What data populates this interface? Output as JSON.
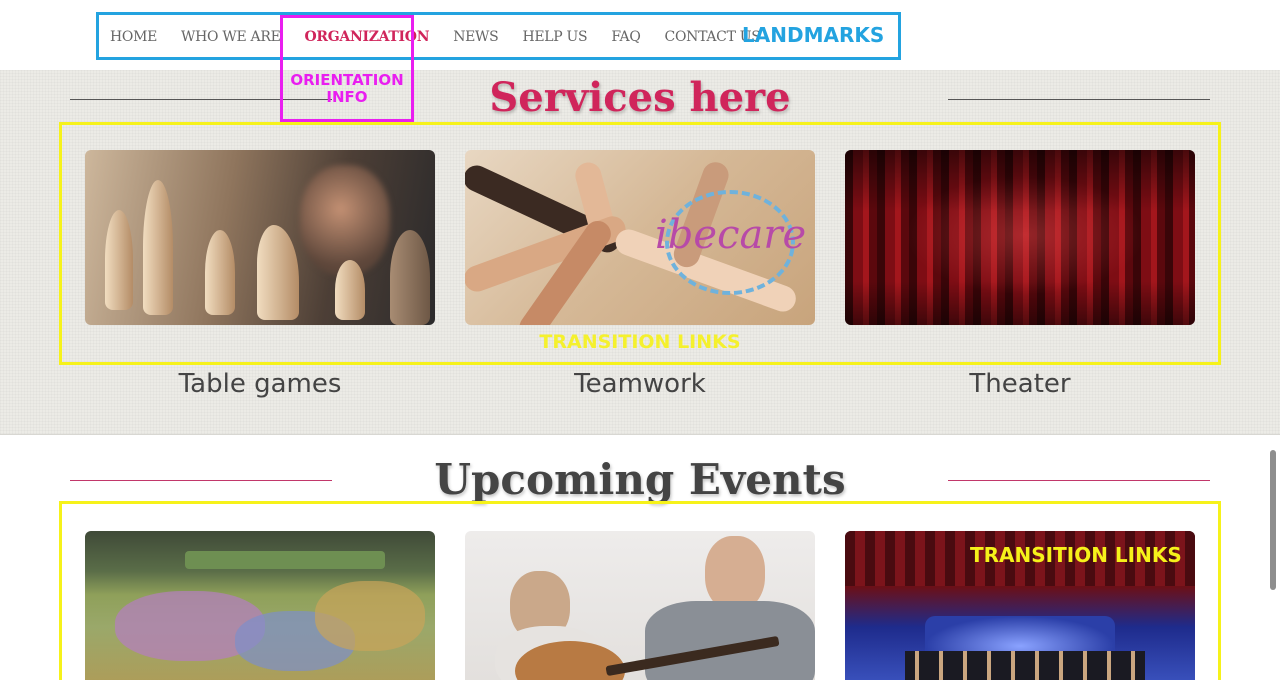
{
  "nav": {
    "items": [
      {
        "label": "HOME"
      },
      {
        "label": "WHO WE ARE"
      },
      {
        "label": "ORGANIZATION"
      },
      {
        "label": "NEWS"
      },
      {
        "label": "HELP US"
      },
      {
        "label": "FAQ"
      },
      {
        "label": "CONTACT US"
      }
    ],
    "active_item": "ORGANIZATION"
  },
  "annotations": {
    "landmarks": "LANDMARKS",
    "orientation_info": "ORIENTATION INFO",
    "transition_links_1": "TRANSITION LINKS",
    "transition_links_2": "TRANSITION LINKS"
  },
  "services": {
    "title": "Services here",
    "cards": [
      {
        "caption": "Table games",
        "image": "chess-photo"
      },
      {
        "caption": "Teamwork",
        "image": "hands-together-photo"
      },
      {
        "caption": "Theater",
        "image": "red-curtain-photo"
      }
    ]
  },
  "events": {
    "title": "Upcoming Events",
    "cards": [
      {
        "image": "giant-map-game-photo"
      },
      {
        "image": "guitar-lesson-photo"
      },
      {
        "image": "theater-stage-photo"
      }
    ]
  },
  "colors": {
    "accent": "#d0255b",
    "landmarks": "#23a3e0",
    "orientation": "#e91ef0",
    "transition": "#f6f21a"
  }
}
